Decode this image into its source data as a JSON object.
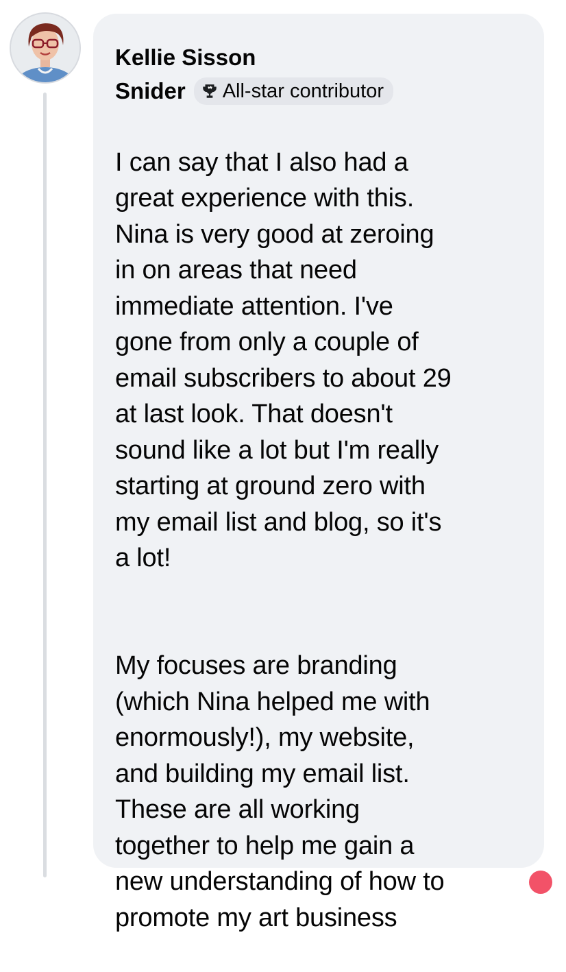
{
  "comment": {
    "author_line1": "Kellie Sisson",
    "author_line2": "Snider",
    "badge": {
      "icon": "trophy-icon",
      "label": "All-star contributor"
    },
    "paragraphs": [
      "I can say that I also had a\ngreat experience with this.\nNina is very good at zeroing\nin on areas that need\nimmediate attention. I've\ngone from only a couple of\nemail subscribers to about 29\nat last look. That doesn't\nsound like a lot but I'm really\nstarting at ground zero with\nmy email list and blog, so it's\na lot!",
      "My focuses are branding\n(which Nina helped me with\nenormously!), my website,\nand building my email list.\nThese are all working\ntogether to help me gain a\nnew understanding of how to\npromote my art business"
    ]
  },
  "colors": {
    "bubble_bg": "#f0f2f5",
    "text": "#050505",
    "badge_bg": "#e4e6eb",
    "thread_line": "#dadde1",
    "reaction_accent": "#f25268"
  }
}
